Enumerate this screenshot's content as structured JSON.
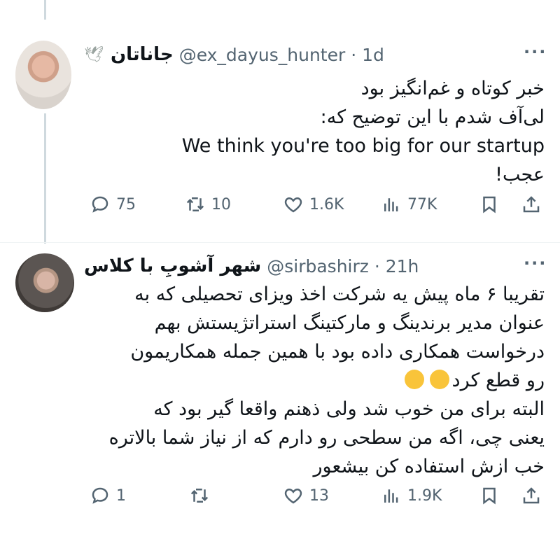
{
  "tweets": [
    {
      "display_name": "جاناتان",
      "handle": "@ex_dayus_hunter · 1d",
      "name_emoji": "🕊",
      "text_lines": [
        "خبر کوتاه و غم‌انگیز بود",
        "لی‌آف شدم با این توضیح که:",
        "We think you're too big for our startup",
        "عجب!"
      ],
      "replies": "75",
      "retweets": "10",
      "likes": "1.6K",
      "views": "77K"
    },
    {
      "display_name": "شهر آشوبِ با کلاس",
      "handle": "@sirbashirz · 21h",
      "text_lines": [
        "تقریبا ۶ ماه پیش یه شرکت اخذ ویزای تحصیلی که به",
        "عنوان مدیر برندینگ و مارکتینگ استراتژیستش بهم",
        "درخواست همکاری داده بود با همین جمله همکاریمون",
        "رو قطع کرد",
        "البته برای من خوب شد ولی ذهنم واقعا گیر بود که",
        "یعنی چی، اگه من سطحی رو دارم که از نیاز شما بالاتره",
        "خب ازش استفاده کن بیشعور"
      ],
      "replies": "1",
      "retweets": "",
      "likes": "13",
      "views": "1.9K"
    }
  ],
  "icons": {
    "reply": "reply-icon",
    "retweet": "retweet-icon",
    "like": "heart-icon",
    "views": "views-icon",
    "bookmark": "bookmark-icon",
    "share": "share-icon",
    "more": "more-icon"
  },
  "more_label": "···",
  "colors": {
    "text": "#0f1419",
    "secondary": "#536471",
    "line": "#cfd9de"
  }
}
